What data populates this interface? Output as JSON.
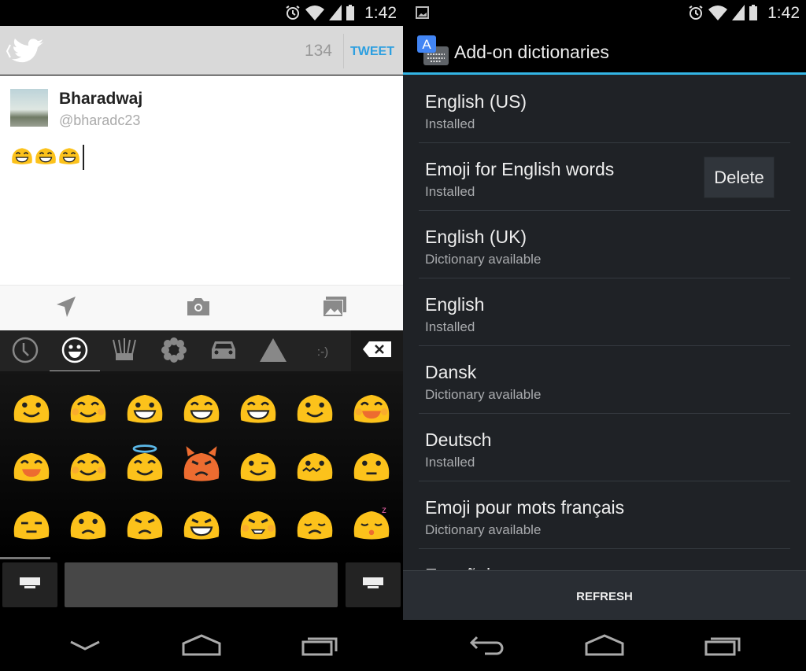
{
  "status": {
    "time": "1:42"
  },
  "twitter": {
    "count": "134",
    "tweet_label": "TWEET",
    "user_name": "Bharadwaj",
    "handle": "@bharadc23",
    "typed_emoji": [
      "grin-tears",
      "grin-tears",
      "grin-tears"
    ]
  },
  "compose_actions": [
    "location-icon",
    "camera-icon",
    "gallery-icon"
  ],
  "emoji_categories": [
    {
      "icon": "recent-clock-icon"
    },
    {
      "icon": "smiley-icon",
      "selected": true
    },
    {
      "icon": "crown-icon"
    },
    {
      "icon": "flower-icon"
    },
    {
      "icon": "car-icon"
    },
    {
      "icon": "triangle-icon"
    },
    {
      "icon": "emoticon-icon",
      "label": ":-)"
    }
  ],
  "emoji": [
    "smile",
    "blush-smile",
    "grin",
    "grin-eyes-closed",
    "grin-tears",
    "slight-smile",
    "laugh-blush",
    "laugh-sweat",
    "squint-blush",
    "halo",
    "devil",
    "wink",
    "zipper",
    "neutral-side",
    "expressionless",
    "confused",
    "angry",
    "angry-teeth",
    "fang-blush",
    "sad-tear",
    "sleepy"
  ],
  "colors": {
    "emoji_yellow": "#fcc21b",
    "devil": "#ed6c30",
    "accent_blue": "#33b5e5",
    "twitter_blue": "#2c9fe0"
  },
  "dictionaries": {
    "title": "Add-on dictionaries",
    "items": [
      {
        "title": "English (US)",
        "subtitle": "Installed"
      },
      {
        "title": "Emoji for English words",
        "subtitle": "Installed",
        "action": "Delete"
      },
      {
        "title": "English (UK)",
        "subtitle": "Dictionary available"
      },
      {
        "title": "English",
        "subtitle": "Installed"
      },
      {
        "title": "Dansk",
        "subtitle": "Dictionary available"
      },
      {
        "title": "Deutsch",
        "subtitle": "Installed"
      },
      {
        "title": "Emoji pour mots français",
        "subtitle": "Dictionary available"
      },
      {
        "title": "Español"
      }
    ],
    "refresh_label": "REFRESH"
  }
}
